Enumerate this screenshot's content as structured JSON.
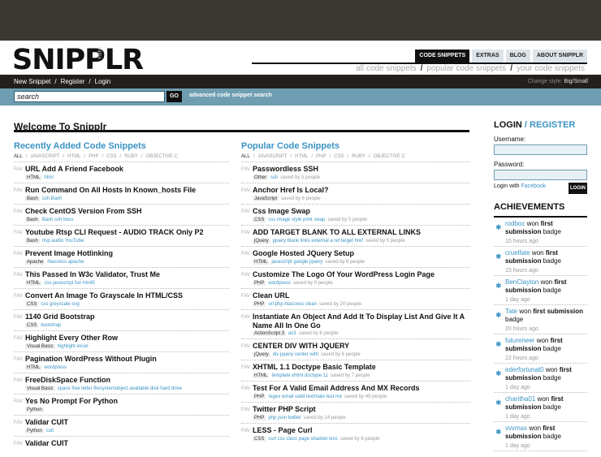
{
  "brand": {
    "logo": "SNIPPLR",
    "logo_sub": "alpha"
  },
  "tabs": [
    "CODE SNIPPETS",
    "EXTRAS",
    "BLOG",
    "ABOUT SNIPPLR"
  ],
  "snippet_links": [
    "all code snippets",
    "popular code snippets",
    "your code snippets"
  ],
  "nav": {
    "links": [
      "New Snippet",
      "Register",
      "Login"
    ],
    "style_label": "Change style:",
    "style_big": "Big",
    "style_small": "Small"
  },
  "search": {
    "value": "search",
    "go": "GO",
    "advanced": "advanced code snippet search"
  },
  "welcome": "Welcome To Snipplr",
  "recent": {
    "title": "Recently Added Code Snippets",
    "filters": [
      "ALL",
      "JAVASCRIPT",
      "HTML",
      "PHP",
      "CSS",
      "RUBY",
      "OBJECTIVE C"
    ],
    "items": [
      {
        "title": "URL Add A Friend Facebook",
        "lang": "HTML",
        "tags": "html"
      },
      {
        "title": "Run Command On All Hosts In Known_hosts File",
        "lang": "Bash",
        "tags": "ssh Bash"
      },
      {
        "title": "Check CentOS Version From SSH",
        "lang": "Bash",
        "tags": "Bash ssh linus"
      },
      {
        "title": "Youtube Rtsp CLI Request - AUDIO TRACK Only P2",
        "lang": "Bash",
        "tags": "rtsp audio YouTube"
      },
      {
        "title": "Prevent Image Hotlinking",
        "lang": "Apache",
        "tags": "htaccess apache"
      },
      {
        "title": "This Passed In W3c Validator, Trust Me",
        "lang": "HTML",
        "tags": "css javascript fun html5"
      },
      {
        "title": "Convert An Image To Grayscale In HTML/CSS",
        "lang": "CSS",
        "tags": "css greyscale svg"
      },
      {
        "title": "1140 Grid Bootstrap",
        "lang": "CSS",
        "tags": "bootstrap"
      },
      {
        "title": "Highlight Every Other Row",
        "lang": "Visual Basic",
        "tags": "highlight excel"
      },
      {
        "title": "Pagination WordPress Without Plugin",
        "lang": "HTML",
        "tags": "wordpress"
      },
      {
        "title": "FreeDiskSpace Function",
        "lang": "Visual Basic",
        "tags": "space free letter filesystemobject available disk hard drive"
      },
      {
        "title": "Yes No Prompt For Python",
        "lang": "Python",
        "tags": ""
      },
      {
        "title": "Validar CUIT",
        "lang": "Python",
        "tags": "cuit"
      },
      {
        "title": "Validar CUIT",
        "lang": "",
        "tags": ""
      }
    ]
  },
  "popular": {
    "title": "Popular Code Snippets",
    "filters": [
      "ALL",
      "JAVASCRIPT",
      "HTML",
      "PHP",
      "CSS",
      "RUBY",
      "OBJECTIVE C"
    ],
    "items": [
      {
        "title": "Passwordless SSH",
        "lang": "Other",
        "tags": "ssh",
        "saved": "saved by 5 people"
      },
      {
        "title": "Anchor Href Is Local?",
        "lang": "JavaScript",
        "tags": "",
        "saved": "saved by 6 people"
      },
      {
        "title": "Css Image Swap",
        "lang": "CSS",
        "tags": "css image style print swap",
        "saved": "saved by 5 people"
      },
      {
        "title": "ADD TARGET BLANK TO ALL EXTERNAL LINKS",
        "lang": "jQuery",
        "tags": "jquery blank links external a rel target href",
        "saved": "saved by 5 people"
      },
      {
        "title": "Google Hosted JQuery Setup",
        "lang": "HTML",
        "tags": "javascript google jquery",
        "saved": "saved by 8 people"
      },
      {
        "title": "Customize The Logo Of Your WordPress Login Page",
        "lang": "PHP",
        "tags": "wordpress",
        "saved": "saved by 9 people"
      },
      {
        "title": "Clean URL",
        "lang": "PHP",
        "tags": "url php htaccess clean",
        "saved": "saved by 20 people"
      },
      {
        "title": "Instantiate An Object And Add It To Display List And Give It A Name All In One Go",
        "lang": "ActionScript 3",
        "tags": "as3",
        "saved": "saved by 6 people"
      },
      {
        "title": "CENTER DIV WITH JQUERY",
        "lang": "jQuery",
        "tags": "div jquery center with",
        "saved": "saved by 6 people"
      },
      {
        "title": "XHTML 1.1 Doctype Basic Template",
        "lang": "HTML",
        "tags": "template xhtml doctype 11",
        "saved": "saved by 7 people"
      },
      {
        "title": "Test For A Valid Email Address And MX Records",
        "lang": "PHP",
        "tags": "regex email valid textmate test mx",
        "saved": "saved by 49 people"
      },
      {
        "title": "Twitter PHP Script",
        "lang": "PHP",
        "tags": "php json twitter",
        "saved": "saved by 14 people"
      },
      {
        "title": "LESS - Page Curl",
        "lang": "CSS",
        "tags": "curl css class page shadow less",
        "saved": "saved by 6 people"
      }
    ]
  },
  "login": {
    "title": "LOGIN",
    "slash": "/",
    "register": "REGISTER",
    "username_label": "Username:",
    "password_label": "Password:",
    "with_label": "Login with",
    "facebook": "Facebook",
    "button": "LOGIN"
  },
  "achievements": {
    "title": "ACHIEVEMENTS",
    "items": [
      {
        "user": "rodboc",
        "text": " won ",
        "badge": "first submission",
        "suffix": " badge",
        "time": "10 hours ago"
      },
      {
        "user": "cruelfate",
        "text": " won ",
        "badge": "first submission",
        "suffix": " badge",
        "time": "15 hours ago"
      },
      {
        "user": "BenClayton",
        "text": " won ",
        "badge": "first submission",
        "suffix": " badge",
        "time": "1 day ago"
      },
      {
        "user": "Tate",
        "text": " won ",
        "badge": "first submission",
        "suffix": " badge",
        "time": "20 hours ago"
      },
      {
        "user": "futureneer",
        "text": " won ",
        "badge": "first submission",
        "suffix": " badge",
        "time": "22 hours ago"
      },
      {
        "user": "ederfortunat0",
        "text": " won ",
        "badge": "first submission",
        "suffix": " badge",
        "time": "1 day ago"
      },
      {
        "user": "charitha01",
        "text": " won ",
        "badge": "first submission",
        "suffix": " badge",
        "time": "1 day ago"
      },
      {
        "user": "vvvmax",
        "text": " won ",
        "badge": "first submission",
        "suffix": " badge",
        "time": "1 day ago"
      }
    ]
  }
}
